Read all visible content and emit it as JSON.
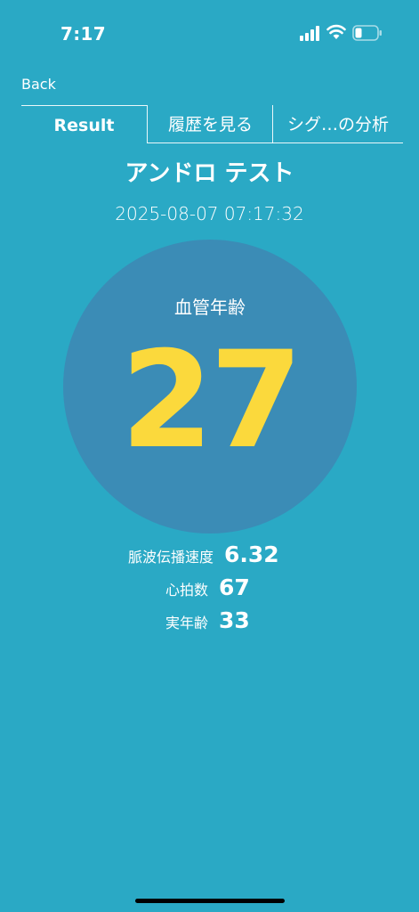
{
  "status_bar": {
    "time": "7:17"
  },
  "nav": {
    "back_label": "Back"
  },
  "tabs": [
    {
      "label": "Result",
      "active": true
    },
    {
      "label": "履歴を見る",
      "active": false
    },
    {
      "label": "シグ…の分析",
      "active": false
    }
  ],
  "result": {
    "test_name": "アンドロ テスト",
    "timestamp": "2025-08-07 07:17:32",
    "vascular_age_label": "血管年齢",
    "vascular_age_value": "27"
  },
  "metrics": {
    "pwv_label": "脈波伝播速度",
    "pwv_value": "6.32",
    "heart_rate_label": "心拍数",
    "heart_rate_value": "67",
    "actual_age_label": "実年齢",
    "actual_age_value": "33"
  },
  "colors": {
    "background": "#2aa9c5",
    "circle": "#3b8cb6",
    "age_value": "#fbd93c",
    "text": "#ffffff"
  },
  "icons": [
    "signal-icon",
    "wifi-icon",
    "battery-icon"
  ]
}
